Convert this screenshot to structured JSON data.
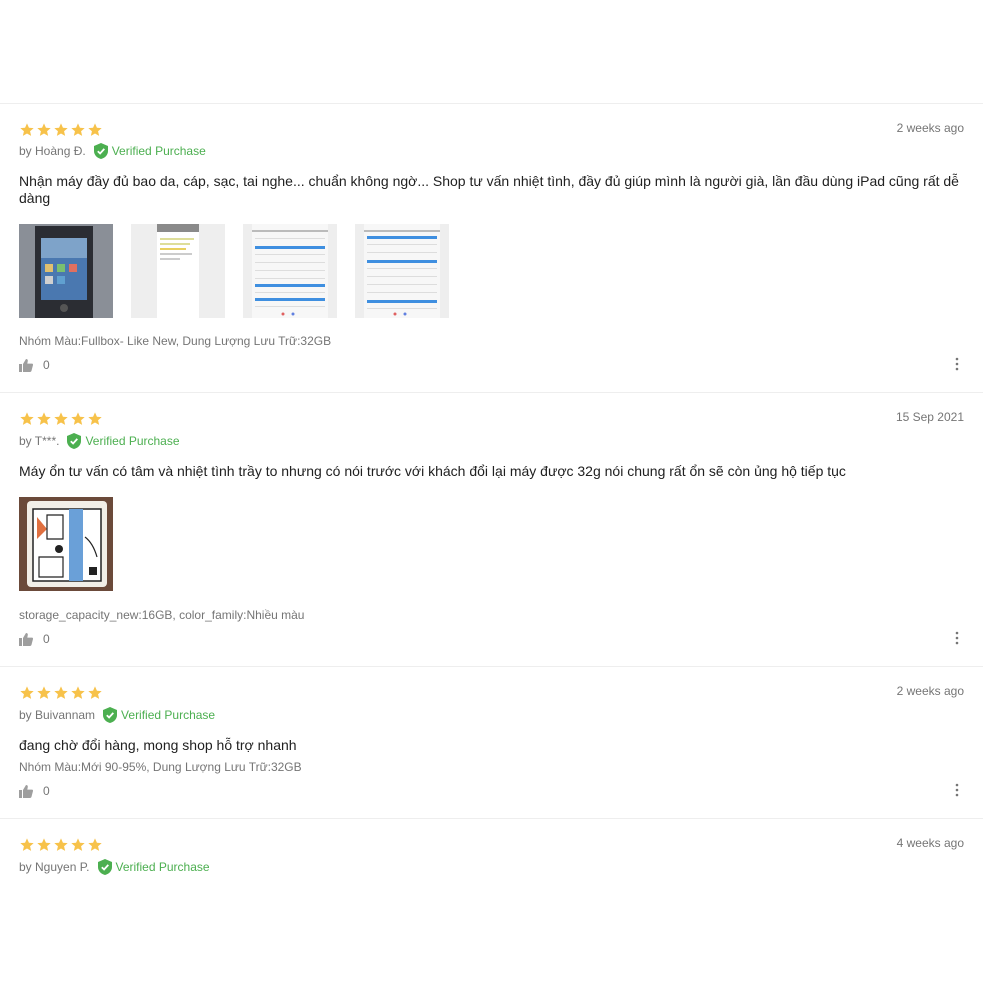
{
  "colors": {
    "star": "#f7c24a",
    "verified": "#4caf50",
    "muted": "#757575",
    "text": "#212121"
  },
  "icons": {
    "star": "star-icon",
    "verified": "verified-shield-icon",
    "like": "thumbs-up-icon",
    "more": "more-vertical-icon"
  },
  "reviews": [
    {
      "rating": 5,
      "author": "by Hoàng Đ.",
      "verified": "Verified Purchase",
      "date": "2 weeks ago",
      "content": "Nhận máy đầy đủ bao da, cáp, sạc, tai nghe... chuẩn không ngờ... Shop tư vấn nhiệt tình, đầy đủ giúp mình là người già, lần đầu dùng iPad cũng rất dễ dàng",
      "sku": "Nhóm Màu:Fullbox- Like New, Dung Lượng Lưu Trữ:32GB",
      "likes": "0"
    },
    {
      "rating": 5,
      "author": "by T***.",
      "verified": "Verified Purchase",
      "date": "15 Sep 2021",
      "content": "Máy ổn tư vấn có tâm và nhiệt tình trầy to nhưng có nói trước với khách đổi lại máy được 32g nói chung rất ổn sẽ còn ủng hộ tiếp tục",
      "sku": "storage_capacity_new:16GB, color_family:Nhiều màu",
      "likes": "0"
    },
    {
      "rating": 5,
      "author": "by Buivannam",
      "verified": "Verified Purchase",
      "date": "2 weeks ago",
      "content": "đang chờ đổi hàng, mong shop hỗ trợ nhanh",
      "sku": "Nhóm Màu:Mới 90-95%, Dung Lượng Lưu Trữ:32GB",
      "likes": "0"
    },
    {
      "rating": 5,
      "author": "by Nguyen P.",
      "verified": "Verified Purchase",
      "date": "4 weeks ago"
    }
  ]
}
